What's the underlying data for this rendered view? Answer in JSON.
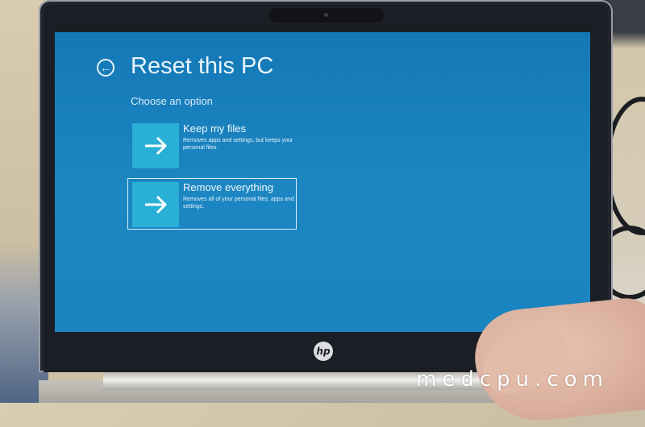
{
  "screen": {
    "title": "Reset this PC",
    "subtitle": "Choose an option",
    "back_icon": "back-arrow-circle-icon",
    "options": [
      {
        "title": "Keep my files",
        "description": "Removes apps and settings, but keeps your personal files.",
        "icon": "arrow-right-icon",
        "selected": false
      },
      {
        "title": "Remove everything",
        "description": "Removes all of your personal files, apps and settings.",
        "icon": "arrow-right-icon",
        "selected": true
      }
    ],
    "colors": {
      "background": "#1a82bf",
      "tile": "#2ab0d6",
      "text": "#e8f4fb"
    }
  },
  "device": {
    "logo": "hp"
  },
  "watermark": "medcpu.com"
}
